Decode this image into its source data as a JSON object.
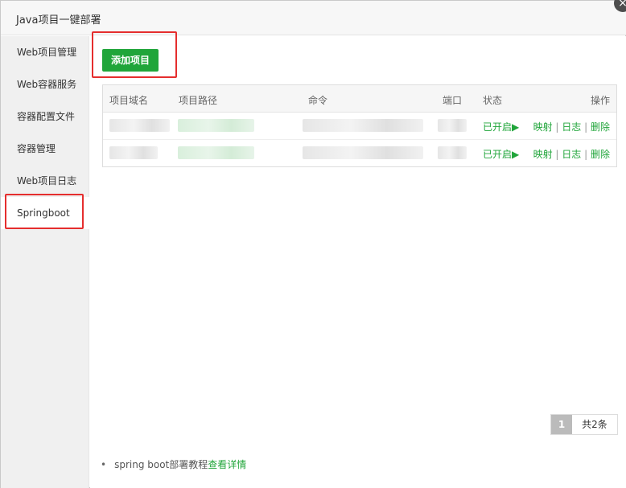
{
  "window": {
    "title": "Java项目一键部署",
    "close_glyph": "×"
  },
  "sidebar": {
    "items": [
      {
        "label": "Web项目管理"
      },
      {
        "label": "Web容器服务"
      },
      {
        "label": "容器配置文件"
      },
      {
        "label": "容器管理"
      },
      {
        "label": "Web项目日志"
      },
      {
        "label": "Springboot"
      }
    ],
    "active": "Springboot"
  },
  "toolbar": {
    "add_label": "添加项目"
  },
  "table": {
    "headers": {
      "domain": "项目域名",
      "path": "项目路径",
      "command": "命令",
      "port": "端口",
      "status": "状态",
      "actions": "操作"
    },
    "rows": [
      {
        "status": "已开启▶",
        "map": "映射",
        "log": "日志",
        "delete": "删除"
      },
      {
        "status": "已开启▶",
        "map": "映射",
        "log": "日志",
        "delete": "删除"
      }
    ],
    "separator": "|"
  },
  "pagination": {
    "current": "1",
    "total": "共2条"
  },
  "footer": {
    "bullet": "•",
    "tip_text": "spring boot部署教程",
    "tip_link": "查看详情"
  },
  "colors": {
    "accent": "#20a53a",
    "highlight": "#e52e2e"
  }
}
